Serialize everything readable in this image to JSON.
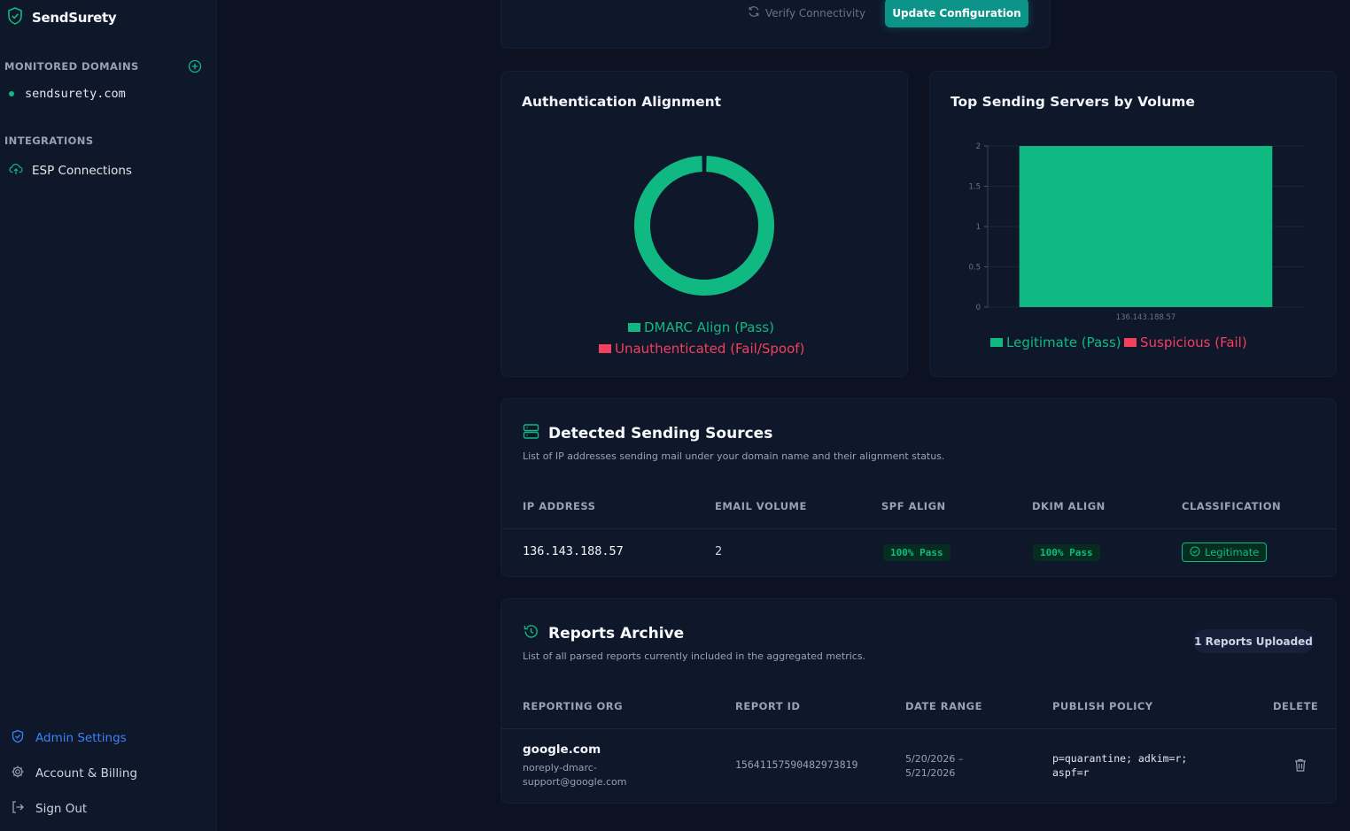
{
  "sidebar": {
    "brand": "SendSurety",
    "monitored_label": "MONITORED DOMAINS",
    "domains": [
      "sendsurety.com"
    ],
    "integrations_label": "INTEGRATIONS",
    "esp_label": "ESP Connections",
    "admin_label": "Admin Settings",
    "account_label": "Account & Billing",
    "signout_label": "Sign Out"
  },
  "actions": {
    "verify_label": "Verify Connectivity",
    "update_label": "Update Configuration"
  },
  "auth_card": {
    "title": "Authentication Alignment",
    "legend": [
      {
        "label": "DMARC Align (Pass)",
        "color": "#10b981"
      },
      {
        "label": "Unauthenticated (Fail/Spoof)",
        "color": "#f43f5e"
      }
    ]
  },
  "servers_card": {
    "title": "Top Sending Servers by Volume",
    "legend": [
      {
        "label": "Legitimate (Pass)",
        "color": "#10b981"
      },
      {
        "label": "Suspicious (Fail)",
        "color": "#f43f5e"
      }
    ]
  },
  "chart_data": [
    {
      "type": "pie",
      "categories": [
        "DMARC Align (Pass)",
        "Unauthenticated (Fail/Spoof)"
      ],
      "values": [
        2,
        0
      ],
      "colors": [
        "#10b981",
        "#f43f5e"
      ],
      "donut": true
    },
    {
      "type": "bar",
      "categories": [
        "136.143.188.57"
      ],
      "series": [
        {
          "name": "Legitimate (Pass)",
          "values": [
            2
          ]
        }
      ],
      "ylim": [
        0,
        2
      ],
      "yticks": [
        "0",
        "0.5",
        "1",
        "1.5",
        "2"
      ],
      "grid": true,
      "legend": "bottom"
    }
  ],
  "sources": {
    "title": "Detected Sending Sources",
    "desc": "List of IP addresses sending mail under your domain name and their alignment status.",
    "headers": [
      "IP ADDRESS",
      "EMAIL VOLUME",
      "SPF ALIGN",
      "DKIM ALIGN",
      "CLASSIFICATION"
    ],
    "rows": [
      {
        "ip": "136.143.188.57",
        "volume": "2",
        "spf": "100% Pass",
        "dkim": "100% Pass",
        "classification": "Legitimate"
      }
    ]
  },
  "archive": {
    "title": "Reports Archive",
    "desc": "List of all parsed reports currently included in the aggregated metrics.",
    "badge": "1 Reports Uploaded",
    "headers": [
      "REPORTING ORG",
      "REPORT ID",
      "DATE RANGE",
      "PUBLISH POLICY",
      "DELETE"
    ],
    "rows": [
      {
        "org": "google.com",
        "org_email_1": "noreply-dmarc-",
        "org_email_2": "support@google.com",
        "report_id": "15641157590482973819",
        "date_1": "5/20/2026 –",
        "date_2": "5/21/2026",
        "policy_1": "p=quarantine; adkim=r;",
        "policy_2": "aspf=r"
      }
    ]
  }
}
